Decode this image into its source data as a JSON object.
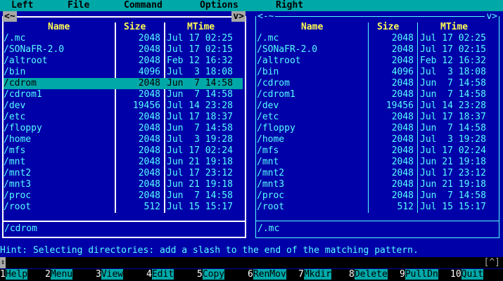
{
  "menu": [
    "Left",
    "File",
    "Command",
    "Options",
    "Right"
  ],
  "left_panel": {
    "corner_left": "<~",
    "corner_right": "v>",
    "headers": {
      "name": "Name",
      "size": "Size",
      "mtime": "MTime"
    },
    "rows": [
      {
        "name": "/.mc",
        "size": "2048",
        "mtime": "Jul 17 02:25"
      },
      {
        "name": "/SONaFR-2.0",
        "size": "2048",
        "mtime": "Jul 17 02:15"
      },
      {
        "name": "/altroot",
        "size": "2048",
        "mtime": "Feb 12 16:32"
      },
      {
        "name": "/bin",
        "size": "4096",
        "mtime": "Jul  3 18:08"
      },
      {
        "name": "/cdrom",
        "size": "2048",
        "mtime": "Jun  7 14:58"
      },
      {
        "name": "/cdrom1",
        "size": "2048",
        "mtime": "Jun  7 14:58"
      },
      {
        "name": "/dev",
        "size": "19456",
        "mtime": "Jul 14 23:28"
      },
      {
        "name": "/etc",
        "size": "2048",
        "mtime": "Jul 17 18:37"
      },
      {
        "name": "/floppy",
        "size": "2048",
        "mtime": "Jun  7 14:58"
      },
      {
        "name": "/home",
        "size": "2048",
        "mtime": "Jul  3 19:28"
      },
      {
        "name": "/mfs",
        "size": "2048",
        "mtime": "Jul 17 02:24"
      },
      {
        "name": "/mnt",
        "size": "2048",
        "mtime": "Jun 21 19:18"
      },
      {
        "name": "/mnt2",
        "size": "2048",
        "mtime": "Jul 17 23:12"
      },
      {
        "name": "/mnt3",
        "size": "2048",
        "mtime": "Jun 21 19:18"
      },
      {
        "name": "/proc",
        "size": "2048",
        "mtime": "Jun  7 14:58"
      },
      {
        "name": "/root",
        "size": "512",
        "mtime": "Jul 15 15:17"
      }
    ],
    "selected_index": 4,
    "status": "/cdrom"
  },
  "right_panel": {
    "corner_left": "<-~",
    "corner_right": "v>",
    "headers": {
      "name": "Name",
      "size": "Size",
      "mtime": "MTime"
    },
    "rows": [
      {
        "name": "/.mc",
        "size": "2048",
        "mtime": "Jul 17 02:25"
      },
      {
        "name": "/SONaFR-2.0",
        "size": "2048",
        "mtime": "Jul 17 02:15"
      },
      {
        "name": "/altroot",
        "size": "2048",
        "mtime": "Feb 12 16:32"
      },
      {
        "name": "/bin",
        "size": "4096",
        "mtime": "Jul  3 18:08"
      },
      {
        "name": "/cdrom",
        "size": "2048",
        "mtime": "Jun  7 14:58"
      },
      {
        "name": "/cdrom1",
        "size": "2048",
        "mtime": "Jun  7 14:58"
      },
      {
        "name": "/dev",
        "size": "19456",
        "mtime": "Jul 14 23:28"
      },
      {
        "name": "/etc",
        "size": "2048",
        "mtime": "Jul 17 18:37"
      },
      {
        "name": "/floppy",
        "size": "2048",
        "mtime": "Jun  7 14:58"
      },
      {
        "name": "/home",
        "size": "2048",
        "mtime": "Jul  3 19:28"
      },
      {
        "name": "/mfs",
        "size": "2048",
        "mtime": "Jul 17 02:24"
      },
      {
        "name": "/mnt",
        "size": "2048",
        "mtime": "Jun 21 19:18"
      },
      {
        "name": "/mnt2",
        "size": "2048",
        "mtime": "Jul 17 23:12"
      },
      {
        "name": "/mnt3",
        "size": "2048",
        "mtime": "Jun 21 19:18"
      },
      {
        "name": "/proc",
        "size": "2048",
        "mtime": "Jun  7 14:58"
      },
      {
        "name": "/root",
        "size": "512",
        "mtime": "Jul 15 15:17"
      }
    ],
    "status": "/.mc"
  },
  "hint": "Hint: Selecting directories: add a slash to the end of the matching pattern.",
  "cmdline_right_mark": "[^]",
  "fkeys": [
    {
      "num": "1",
      "label": "Help"
    },
    {
      "num": "2",
      "label": "Menu"
    },
    {
      "num": "3",
      "label": "View"
    },
    {
      "num": "4",
      "label": "Edit"
    },
    {
      "num": "5",
      "label": "Copy"
    },
    {
      "num": "6",
      "label": "RenMov"
    },
    {
      "num": "7",
      "label": "Mkdir"
    },
    {
      "num": "8",
      "label": "Delete"
    },
    {
      "num": "9",
      "label": "PullDn"
    },
    {
      "num": "10",
      "label": "Quit"
    }
  ],
  "colors": {
    "background": "#0000a8",
    "text": "#57ffff",
    "header": "#ffff55",
    "selection": "#00a8a8"
  }
}
